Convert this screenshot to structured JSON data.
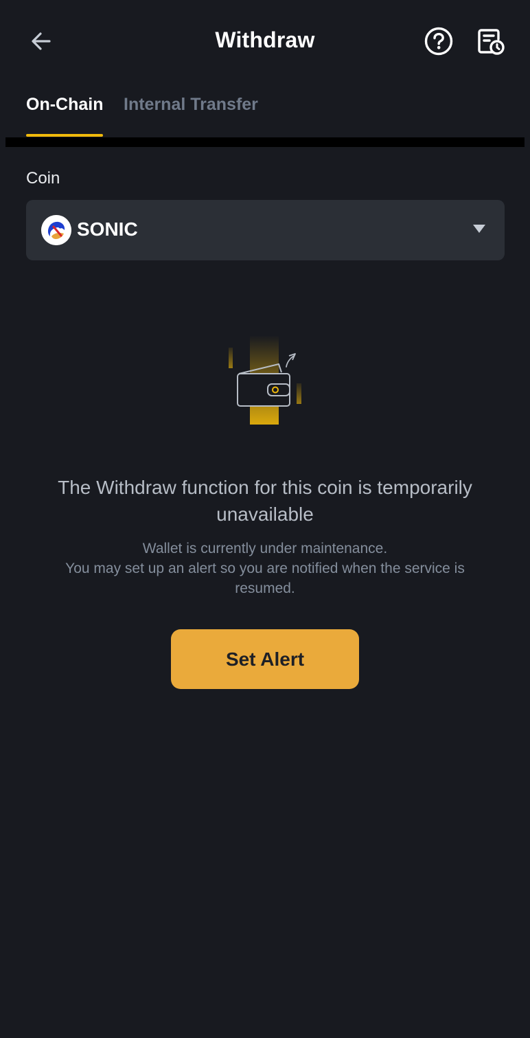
{
  "header": {
    "title": "Withdraw",
    "back_icon": "arrow-left-icon",
    "help_icon": "question-circle-icon",
    "history_icon": "history-document-icon"
  },
  "tabs": [
    {
      "label": "On-Chain",
      "active": true
    },
    {
      "label": "Internal Transfer",
      "active": false
    }
  ],
  "coin": {
    "label": "Coin",
    "selected": "SONIC",
    "dropdown_icon": "caret-down-icon"
  },
  "notice": {
    "title": "The Withdraw function for this coin is temporarily unavailable",
    "line1": "Wallet is currently under maintenance.",
    "line2": "You may set up an alert so you are notified when the service is",
    "line3": "resumed."
  },
  "action": {
    "label": "Set Alert"
  },
  "colors": {
    "background": "#181A20",
    "accent": "#F0B90B",
    "button": "#EAAA3B",
    "field": "#2B2F36"
  }
}
